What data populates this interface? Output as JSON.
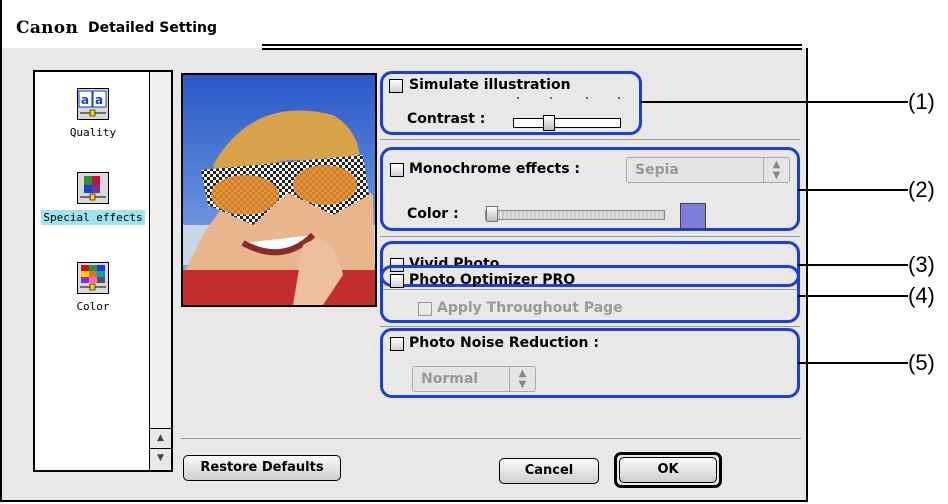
{
  "window": {
    "brand": "Canon",
    "title": "Detailed Setting"
  },
  "sidebar": {
    "items": [
      {
        "label": "Quality",
        "icon": "quality-icon"
      },
      {
        "label": "Special effects",
        "icon": "special-effects-icon",
        "selected": true
      },
      {
        "label": "Color",
        "icon": "color-icon"
      }
    ]
  },
  "options": {
    "simulate": {
      "label": "Simulate illustration",
      "checked": false,
      "contrast_label": "Contrast :"
    },
    "monochrome": {
      "label": "Monochrome effects :",
      "checked": false,
      "select_value": "Sepia",
      "color_label": "Color :",
      "swatch_color": "#7d7bdc"
    },
    "vivid": {
      "label": "Vivid Photo",
      "checked": false
    },
    "optimizer": {
      "label": "Photo Optimizer PRO",
      "checked": false,
      "sub_label": "Apply Throughout Page",
      "sub_checked": false
    },
    "noise": {
      "label": "Photo Noise Reduction :",
      "checked": false,
      "select_value": "Normal"
    }
  },
  "callouts": [
    "(1)",
    "(2)",
    "(3)",
    "(4)",
    "(5)"
  ],
  "buttons": {
    "restore": "Restore Defaults",
    "cancel": "Cancel",
    "ok": "OK"
  },
  "colors": {
    "highlight_box": "#1a3ed6",
    "selected_bg": "#9de3f0"
  }
}
